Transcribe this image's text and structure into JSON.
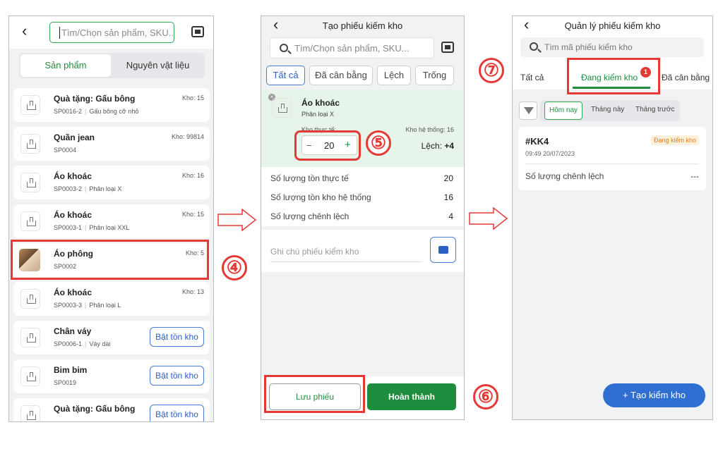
{
  "screen1": {
    "search_placeholder": "Tìm/Chọn sản phẩm, SKU...",
    "tabs": [
      "Sản phẩm",
      "Nguyên vật liệu"
    ],
    "products": [
      {
        "name": "Quà tặng: Gấu bông",
        "sku": "SP0016-2",
        "variant": "Gấu bông cỡ nhỏ",
        "stock": "Kho: 15",
        "button": ""
      },
      {
        "name": "Quần jean",
        "sku": "SP0004",
        "variant": "",
        "stock": "Kho: 99814",
        "button": ""
      },
      {
        "name": "Áo khoác",
        "sku": "SP0003-2",
        "variant": "Phân loại X",
        "stock": "Kho: 16",
        "button": ""
      },
      {
        "name": "Áo khoác",
        "sku": "SP0003-1",
        "variant": "Phân loại XXL",
        "stock": "Kho: 15",
        "button": ""
      },
      {
        "name": "Áo phông",
        "sku": "SP0002",
        "variant": "",
        "stock": "Kho: 5",
        "button": ""
      },
      {
        "name": "Áo khoác",
        "sku": "SP0003-3",
        "variant": "Phân loại L",
        "stock": "Kho: 13",
        "button": ""
      },
      {
        "name": "Chân váy",
        "sku": "SP0006-1",
        "variant": "Váy dài",
        "stock": "",
        "button": "Bật tồn kho"
      },
      {
        "name": "Bim bim",
        "sku": "SP0019",
        "variant": "",
        "stock": "",
        "button": "Bật tồn kho"
      },
      {
        "name": "Quà tặng: Gấu bông",
        "sku": "",
        "variant": "",
        "stock": "",
        "button": "Bật tồn kho"
      }
    ]
  },
  "screen2": {
    "title": "Tạo phiếu kiếm kho",
    "search_placeholder": "Tìm/Chọn sản phẩm, SKU...",
    "filters": [
      "Tất cả",
      "Đã cân bằng",
      "Lệch",
      "Trống"
    ],
    "item": {
      "name": "Áo khoác",
      "variant": "Phân loại X",
      "actual_label": "Kho thực tế:",
      "system_label": "Kho hệ thống: 16",
      "minus": "−",
      "qty": "20",
      "plus": "+",
      "diff_label": "Lệch:",
      "diff_value": "+4"
    },
    "stats": [
      {
        "label": "Số lượng tồn thực tế",
        "value": "20"
      },
      {
        "label": "Số lượng tồn kho hệ thống",
        "value": "16"
      },
      {
        "label": "Số lượng chênh lệch",
        "value": "4"
      }
    ],
    "note_placeholder": "Ghi chú phiếu kiểm kho",
    "save_label": "Lưu phiếu",
    "done_label": "Hoàn thành"
  },
  "screen3": {
    "title": "Quản lý phiếu kiếm kho",
    "search_placeholder": "Tìm mã phiếu kiểm kho",
    "tabs": [
      "Tất cả",
      "Đang kiểm kho",
      "Đã cân bằng k"
    ],
    "badge": "1",
    "ranges": [
      "Hôm nay",
      "Tháng này",
      "Tháng trước"
    ],
    "card": {
      "code": "#KK4",
      "time": "09:49 20/07/2023",
      "status": "Đang kiểm kho",
      "label": "Số lượng chênh lệch",
      "value": "---"
    },
    "fab_label": "Tạo kiểm kho"
  },
  "steps": [
    "④",
    "⑤",
    "⑥",
    "⑦"
  ],
  "colors": {
    "green": "#1e8e3e",
    "blue": "#2d5fc4",
    "red": "#e53935",
    "orange": "#e67c1b"
  }
}
